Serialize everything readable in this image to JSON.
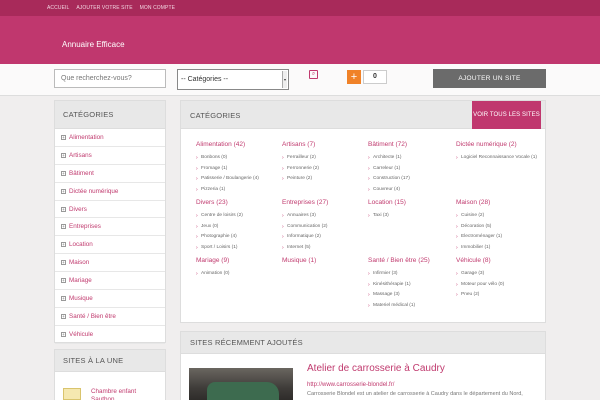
{
  "top_nav": [
    "ACCUEIL",
    "AJOUTER VOTRE SITE",
    "MON COMPTE"
  ],
  "site_title": "Annuaire Efficace",
  "search": {
    "placeholder": "Que recherchez-vous?",
    "category_select": "-- Catégories --"
  },
  "counter_value": "0",
  "add_site_label": "AJOUTER UN SITE",
  "sidebar": {
    "title": "CATÉGORIES",
    "items": [
      "Alimentation",
      "Artisans",
      "Bâtiment",
      "Dictée numérique",
      "Divers",
      "Entreprises",
      "Location",
      "Maison",
      "Mariage",
      "Musique",
      "Santé / Bien être",
      "Véhicule"
    ]
  },
  "une": {
    "title": "SITES À LA UNE",
    "first_item": "Chambre enfant Sauthon"
  },
  "categories_panel": {
    "title": "CATÉGORIES",
    "view_all_label": "VOIR TOUS LES SITES",
    "columns": [
      {
        "title": "Alimentation (42)",
        "subs": [
          "Bonbons (0)",
          "Fromage (1)",
          "Patisserie / Boulangerie (4)",
          "Pizzeria (1)"
        ]
      },
      {
        "title": "Artisans (7)",
        "subs": [
          "Ferrailleur (2)",
          "Ferronnerie (2)",
          "Peinture (2)"
        ]
      },
      {
        "title": "Bâtiment (72)",
        "subs": [
          "Architecte (1)",
          "Carreleur (1)",
          "Construction (17)",
          "Couvreur (4)"
        ]
      },
      {
        "title": "Dictée numérique (2)",
        "subs": [
          "Logiciel Reconnaissance Vocale (1)"
        ]
      },
      {
        "title": "Divers (23)",
        "subs": [
          "Centre de loisirs (2)",
          "Jeux (0)",
          "Photographie (4)",
          "Sport / Loisirs (1)"
        ]
      },
      {
        "title": "Entreprises (27)",
        "subs": [
          "Annuaires (3)",
          "Communication (2)",
          "Informatique (2)",
          "Internet (5)"
        ]
      },
      {
        "title": "Location (15)",
        "subs": [
          "Taxi (3)"
        ]
      },
      {
        "title": "Maison (28)",
        "subs": [
          "Cuisine (2)",
          "Décoration (5)",
          "Electroménager (1)",
          "Immobilier (1)"
        ]
      },
      {
        "title": "Mariage (9)",
        "subs": [
          "Animation (0)"
        ]
      },
      {
        "title": "Musique (1)",
        "subs": []
      },
      {
        "title": "Santé / Bien être (25)",
        "subs": [
          "Infirmier (3)",
          "Kinésithérapie (1)",
          "Massage (3)",
          "Materiel médical (1)"
        ]
      },
      {
        "title": "Véhicule (8)",
        "subs": [
          "Garage (3)",
          "Moteur pour vélo (0)",
          "Pneu (2)"
        ]
      }
    ]
  },
  "recent": {
    "title": "SITES RÉCEMMENT AJOUTÉS",
    "item_title": "Atelier de carrosserie à Caudry",
    "item_url": "http://www.carrosserie-blondel.fr/",
    "item_desc": "Carrosserie Blondel est un atelier de carrosserie à Caudry dans le département du Nord,"
  },
  "colors": {
    "brand": "#c0376e",
    "topbar": "#a82a5a",
    "accent_orange": "#f08228",
    "button_gray": "#6b6b6b"
  },
  "icons": [
    "search-icon",
    "plus-icon",
    "expand-icon",
    "chevron-right-icon",
    "dropdown-arrow-icon"
  ]
}
